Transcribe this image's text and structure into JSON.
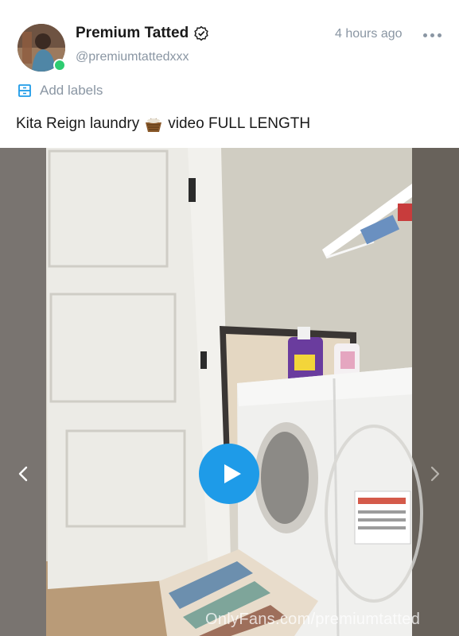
{
  "post": {
    "author_name": "Premium Tatted",
    "author_handle": "@premiumtattedxxx",
    "timestamp": "4 hours ago",
    "add_labels": "Add labels",
    "caption_before": "Kita Reign laundry",
    "caption_after": "video FULL LENGTH"
  },
  "media": {
    "watermark": "OnlyFans.com/premiumtatted"
  },
  "icons": {
    "verified": "verified-badge-icon",
    "more": "more-horizontal-icon",
    "labels": "label-icon",
    "basket": "laundry-basket-emoji",
    "play": "play-icon",
    "prev": "chevron-left-icon",
    "next": "chevron-right-icon"
  },
  "colors": {
    "accent": "#1e9be8",
    "muted_text": "#8a96a3",
    "online": "#2ecc71"
  }
}
